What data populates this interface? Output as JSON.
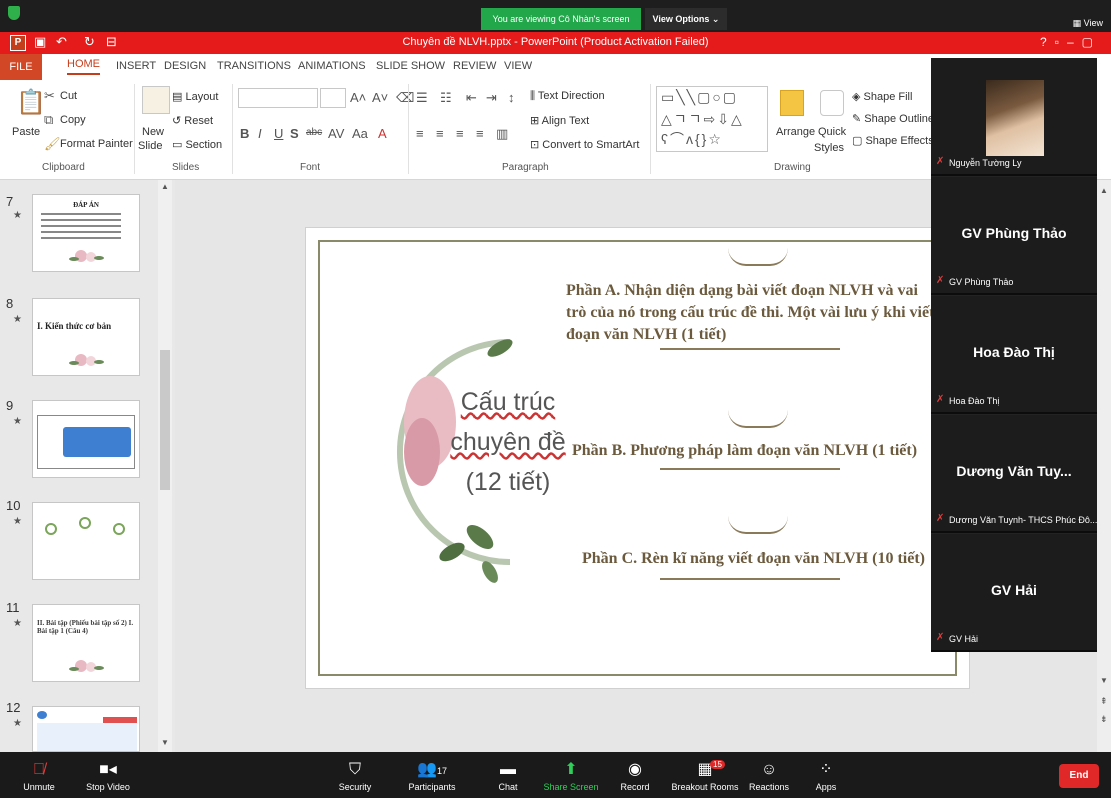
{
  "zoom": {
    "viewing_banner": "You are viewing Cô Nhàn's screen",
    "view_options": "View Options ⌄",
    "view_button": "View"
  },
  "ppt": {
    "title": "Chuyên đề NLVH.pptx -  PowerPoint (Product Activation Failed)",
    "app_icon": "P",
    "tabs": [
      "FILE",
      "HOME",
      "INSERT",
      "DESIGN",
      "TRANSITIONS",
      "ANIMATIONS",
      "SLIDE SHOW",
      "REVIEW",
      "VIEW"
    ],
    "ribbon": {
      "paste": "Paste",
      "cut": "Cut",
      "copy": "Copy",
      "format_painter": "Format Painter",
      "new_slide_1": "New",
      "new_slide_2": "Slide",
      "layout": "Layout",
      "reset": "Reset",
      "section": "Section",
      "text_direction": "Text Direction",
      "align_text": "Align Text",
      "convert_smartart": "Convert to SmartArt",
      "arrange": "Arrange",
      "quick_styles_1": "Quick",
      "quick_styles_2": "Styles",
      "shape_fill": "Shape Fill",
      "shape_outline": "Shape Outline",
      "shape_effects": "Shape Effects",
      "groups": [
        "Clipboard",
        "Slides",
        "Font",
        "Paragraph",
        "Drawing"
      ]
    },
    "thumbnails": [
      {
        "num": "7",
        "title": "ĐÁP ÁN"
      },
      {
        "num": "8",
        "title": "I. Kiến thức cơ bản"
      },
      {
        "num": "9",
        "title": ""
      },
      {
        "num": "10",
        "title": ""
      },
      {
        "num": "11",
        "title": "II. Bài tập (Phiếu bài tập số 2) I. Bài tập 1 (Câu 4)"
      },
      {
        "num": "12",
        "title": ""
      }
    ],
    "slide": {
      "title_line1": "Cấu trúc",
      "title_line2": "chuyên đề",
      "title_line3": "(12 tiết)",
      "part_a": "Phần A. Nhận diện dạng bài viết đoạn NLVH và vai trò của nó trong cấu trúc đề thi. Một vài lưu ý khi viết đoạn văn NLVH (1 tiết)",
      "part_b": "Phần B. Phương pháp làm đoạn văn NLVH (1 tiết)",
      "part_c": "Phần C. Rèn kĩ năng viết đoạn văn NLVH (10 tiết)"
    }
  },
  "participants": [
    {
      "big": "",
      "small": "Nguyễn Tường Ly",
      "has_video": true
    },
    {
      "big": "GV Phùng Thảo",
      "small": "GV Phùng Thảo",
      "has_video": false
    },
    {
      "big": "Hoa Đào Thị",
      "small": "Hoa Đào Thị",
      "has_video": false
    },
    {
      "big": "Dương Văn Tuy...",
      "small": "Dương Văn Tuynh- THCS Phúc Đô...",
      "has_video": false
    },
    {
      "big": "GV Hải",
      "small": "GV Hải",
      "has_video": false
    }
  ],
  "toolbar": {
    "unmute": "Unmute",
    "stop_video": "Stop Video",
    "security": "Security",
    "participants": "Participants",
    "participants_count": "17",
    "chat": "Chat",
    "share_screen": "Share Screen",
    "record": "Record",
    "breakout_rooms": "Breakout Rooms",
    "breakout_badge": "15",
    "reactions": "Reactions",
    "apps": "Apps",
    "end": "End"
  }
}
